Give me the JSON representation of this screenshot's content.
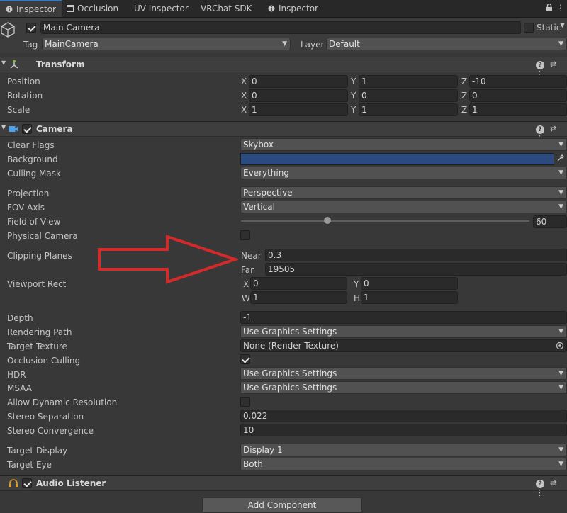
{
  "tabs": [
    {
      "label": "Inspector",
      "icon": "info-icon"
    },
    {
      "label": "Occlusion",
      "icon": "window-icon"
    },
    {
      "label": "UV Inspector"
    },
    {
      "label": "VRChat SDK"
    },
    {
      "label": "Inspector",
      "icon": "info-icon"
    }
  ],
  "object": {
    "name": "Main Camera",
    "static_label": "Static",
    "tag_label": "Tag",
    "tag_value": "MainCamera",
    "layer_label": "Layer",
    "layer_value": "Default"
  },
  "transform": {
    "title": "Transform",
    "rows": [
      {
        "label": "Position",
        "x": "0",
        "y": "1",
        "z": "-10"
      },
      {
        "label": "Rotation",
        "x": "0",
        "y": "0",
        "z": "0"
      },
      {
        "label": "Scale",
        "x": "1",
        "y": "1",
        "z": "1"
      }
    ]
  },
  "axes": {
    "x": "X",
    "y": "Y",
    "z": "Z",
    "w": "W",
    "h": "H"
  },
  "camera": {
    "title": "Camera",
    "clear_flags": {
      "label": "Clear Flags",
      "value": "Skybox"
    },
    "background": {
      "label": "Background",
      "color": "#2a4a80"
    },
    "culling_mask": {
      "label": "Culling Mask",
      "value": "Everything"
    },
    "projection": {
      "label": "Projection",
      "value": "Perspective"
    },
    "fov_axis": {
      "label": "FOV Axis",
      "value": "Vertical"
    },
    "field_of_view": {
      "label": "Field of View",
      "value": "60",
      "fraction": 0.3
    },
    "physical_camera": {
      "label": "Physical Camera",
      "checked": false
    },
    "clipping": {
      "label": "Clipping Planes",
      "near_label": "Near",
      "near": "0.3",
      "far_label": "Far",
      "far": "19505"
    },
    "viewport": {
      "label": "Viewport Rect",
      "x": "0",
      "y": "0",
      "w": "1",
      "h": "1"
    },
    "depth": {
      "label": "Depth",
      "value": "-1"
    },
    "rendering_path": {
      "label": "Rendering Path",
      "value": "Use Graphics Settings"
    },
    "target_texture": {
      "label": "Target Texture",
      "value": "None (Render Texture)"
    },
    "occlusion_culling": {
      "label": "Occlusion Culling",
      "checked": true
    },
    "hdr": {
      "label": "HDR",
      "value": "Use Graphics Settings"
    },
    "msaa": {
      "label": "MSAA",
      "value": "Use Graphics Settings"
    },
    "dynamic_resolution": {
      "label": "Allow Dynamic Resolution",
      "checked": false
    },
    "stereo_separation": {
      "label": "Stereo Separation",
      "value": "0.022"
    },
    "stereo_convergence": {
      "label": "Stereo Convergence",
      "value": "10"
    },
    "target_display": {
      "label": "Target Display",
      "value": "Display 1"
    },
    "target_eye": {
      "label": "Target Eye",
      "value": "Both"
    }
  },
  "audio_listener": {
    "title": "Audio Listener"
  },
  "add_component": {
    "label": "Add Component"
  },
  "annotation": {
    "arrow_color": "#d42a2a"
  }
}
